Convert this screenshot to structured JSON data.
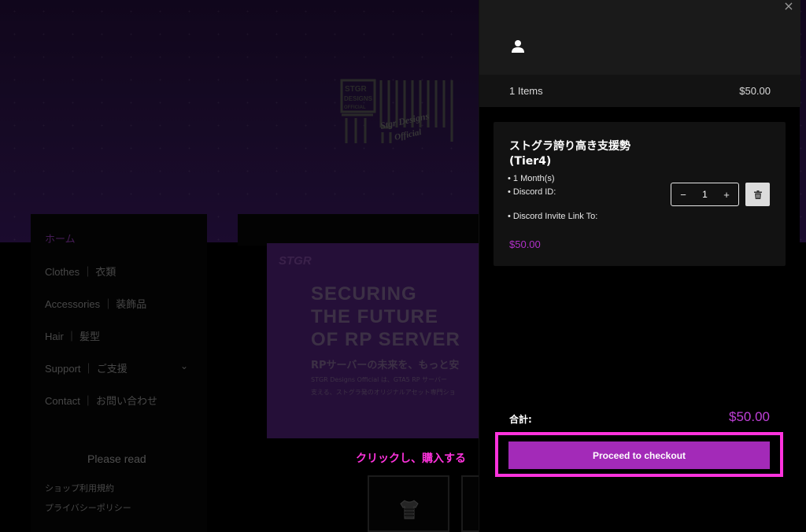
{
  "background_page": {
    "nav": {
      "home": "ホーム",
      "clothes": "Clothes ｜ 衣類",
      "accessories": "Accessories ｜ 装飾品",
      "hair": "Hair ｜ 髪型",
      "support": "Support ｜ ご支援",
      "contact": "Contact ｜ お問い合わせ"
    },
    "please_read": "Please read",
    "footer_links": [
      "ショップ利用規約",
      "プライバシーポリシー"
    ],
    "banner": {
      "brand": "STGR",
      "headline": "SECURING\nTHE FUTURE\nOF RP SERVER",
      "subheadline": "RPサーバーの未来を、もっと安",
      "body_line1": "STGR Designs Official は、GTA5 RP サーバー",
      "body_line2": "支える、ストグラ発のオリジナルアセット専門ショ"
    },
    "annotation": "クリックし、購入する",
    "category_cards": [
      {
        "icon": "shirt-icon"
      }
    ]
  },
  "cart": {
    "summary": {
      "count": "1 Items",
      "total": "$50.00"
    },
    "item": {
      "title": "ストグラ誇り高き支援勢 (Tier4)",
      "meta": [
        "• 1 Month(s)",
        "• Discord ID:",
        "• Discord Invite Link To:"
      ],
      "price": "$50.00",
      "quantity": "1",
      "qty_minus": "−",
      "qty_plus": "+"
    },
    "total_label": "合計:",
    "total_value": "$50.00",
    "checkout_label": "Proceed to checkout",
    "close_glyph": "×"
  },
  "colors": {
    "accent": "#a32ab8",
    "price": "#b030c8",
    "highlight": "#ff33dd"
  }
}
